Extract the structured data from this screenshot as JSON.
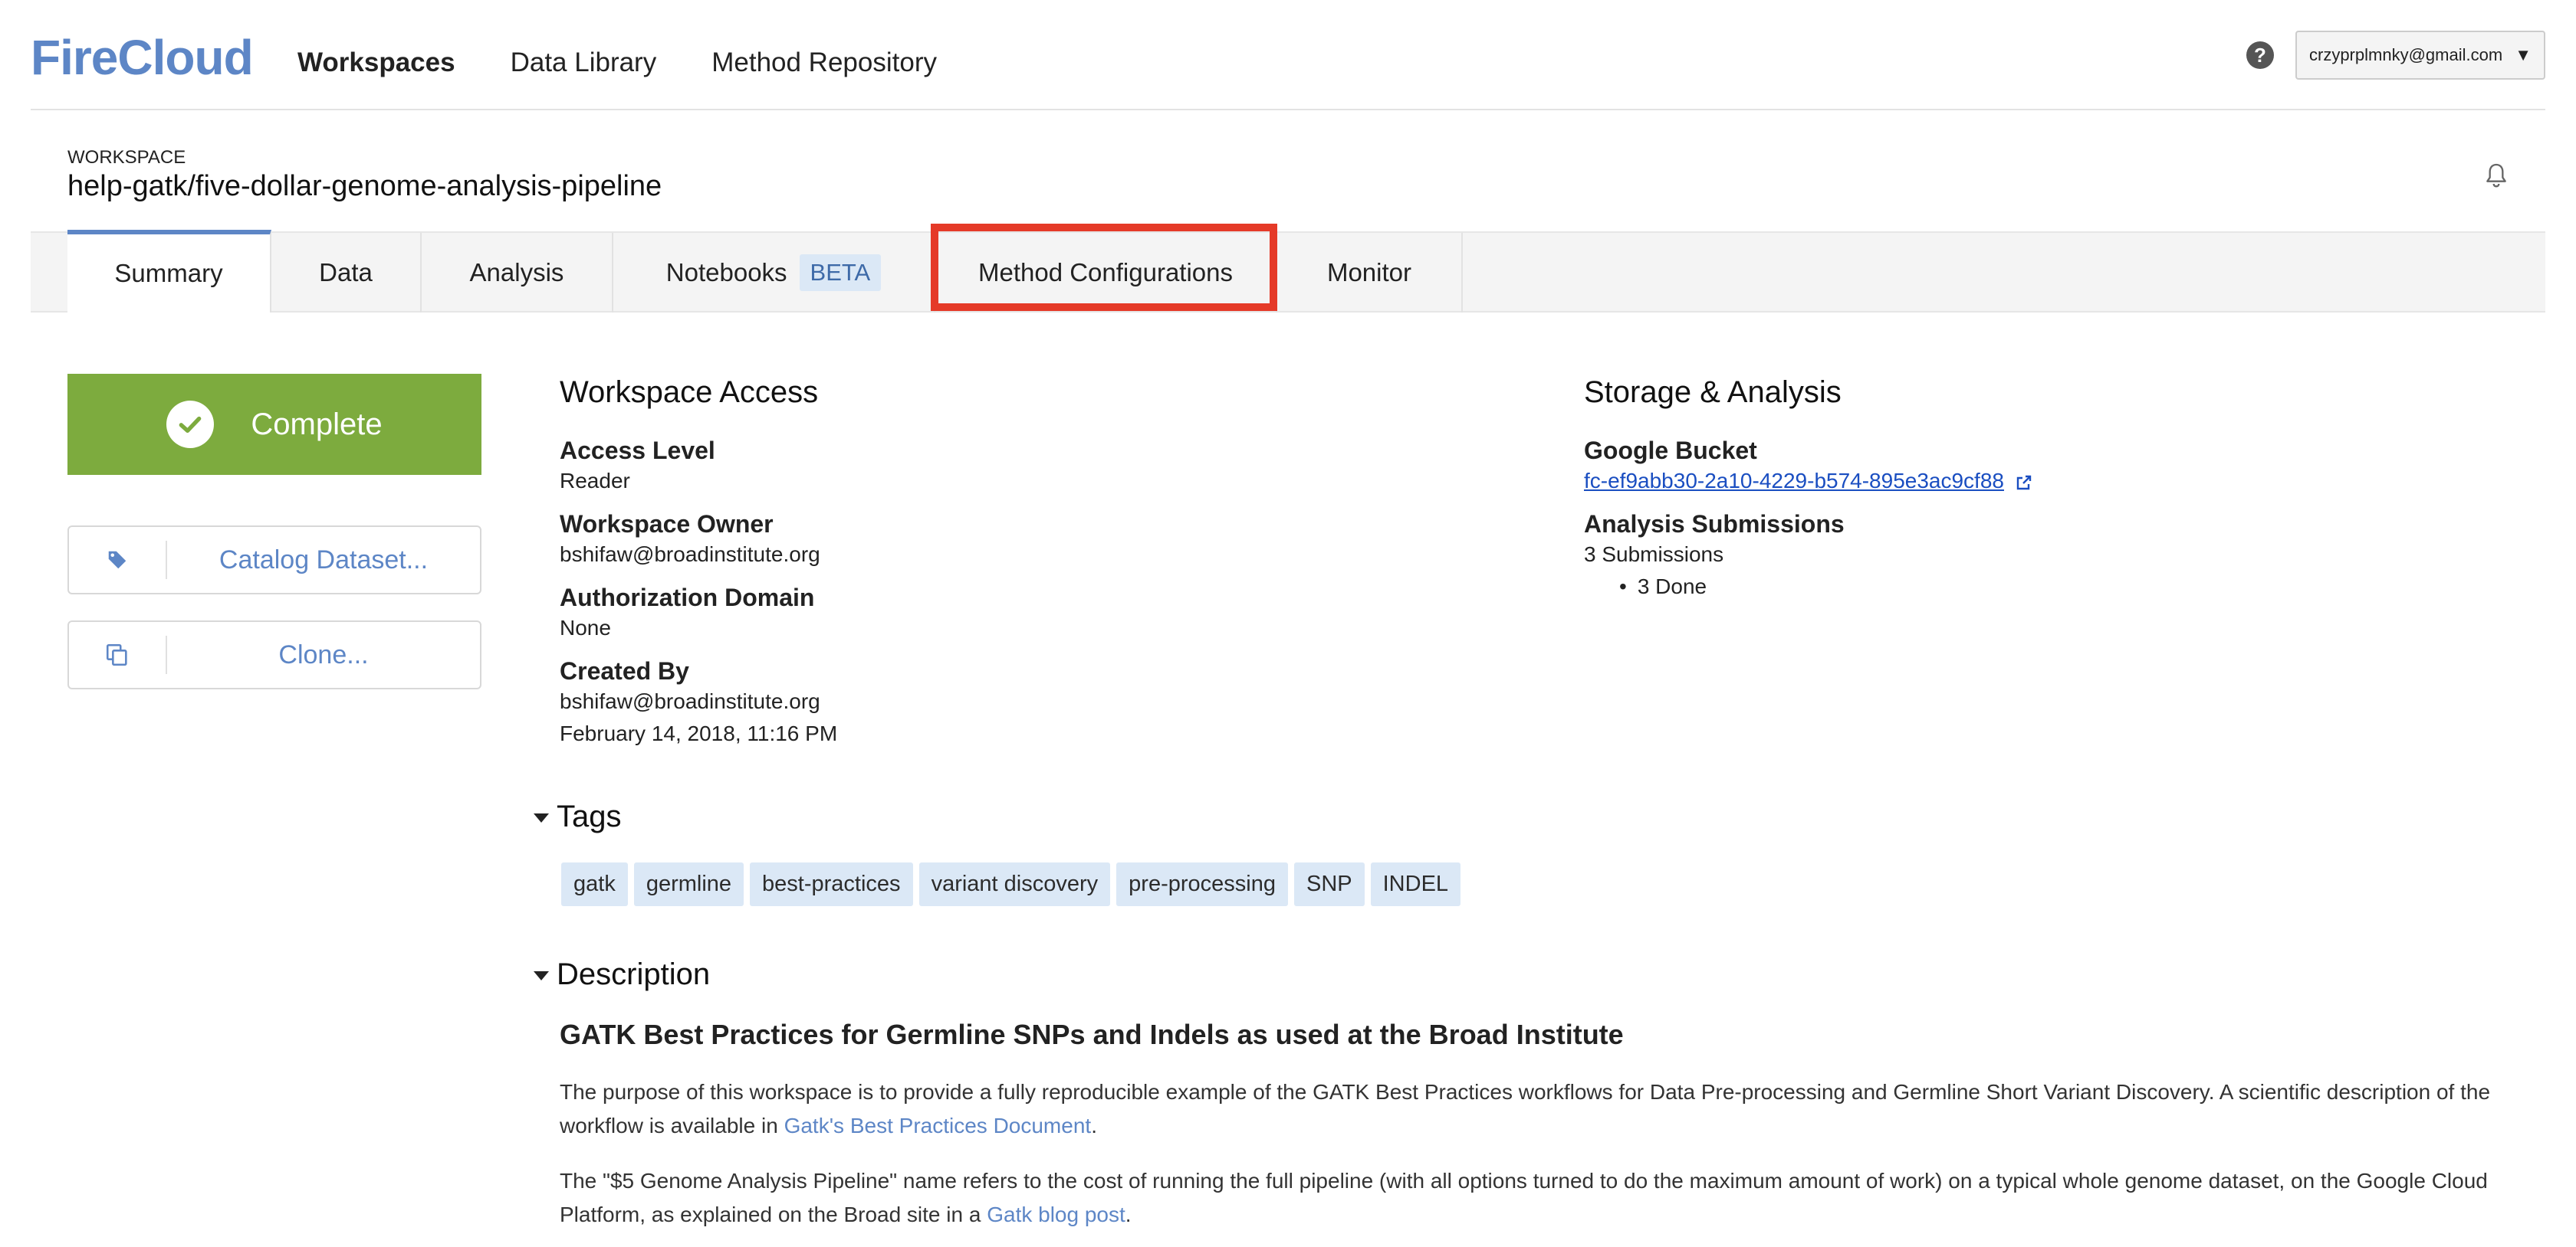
{
  "app": {
    "logo": "FireCloud"
  },
  "nav": {
    "workspaces": "Workspaces",
    "data_library": "Data Library",
    "method_repository": "Method Repository"
  },
  "header": {
    "help_icon": "question-circle-icon",
    "user_email": "crzyprplmnky@gmail.com",
    "user_caret": "▼"
  },
  "workspace": {
    "label": "WORKSPACE",
    "name": "help-gatk/five-dollar-genome-analysis-pipeline"
  },
  "tabs": [
    {
      "label": "Summary",
      "active": true
    },
    {
      "label": "Data"
    },
    {
      "label": "Analysis"
    },
    {
      "label": "Notebooks",
      "badge": "BETA"
    },
    {
      "label": "Method Configurations",
      "highlighted": true
    },
    {
      "label": "Monitor"
    }
  ],
  "sidebar": {
    "status": "Complete",
    "catalog_button": "Catalog Dataset...",
    "clone_button": "Clone..."
  },
  "access": {
    "title": "Workspace Access",
    "access_level_label": "Access Level",
    "access_level_value": "Reader",
    "owner_label": "Workspace Owner",
    "owner_value": "bshifaw@broadinstitute.org",
    "auth_domain_label": "Authorization Domain",
    "auth_domain_value": "None",
    "created_by_label": "Created By",
    "created_by_value": "bshifaw@broadinstitute.org",
    "created_date": "February 14, 2018, 11:16 PM"
  },
  "storage": {
    "title": "Storage & Analysis",
    "bucket_label": "Google Bucket",
    "bucket_value": "fc-ef9abb30-2a10-4229-b574-895e3ac9cf88",
    "submissions_label": "Analysis Submissions",
    "submissions_count": "3 Submissions",
    "submissions_done": "3 Done"
  },
  "tags": {
    "title": "Tags",
    "items": [
      "gatk",
      "germline",
      "best-practices",
      "variant discovery",
      "pre-processing",
      "SNP",
      "INDEL"
    ]
  },
  "description": {
    "title": "Description",
    "heading": "GATK Best Practices for Germline SNPs and Indels as used at the Broad Institute",
    "para1_text": "The purpose of this workspace is to provide a fully reproducible example of the GATK Best Practices workflows for Data Pre-processing and Germline Short Variant Discovery. A scientific description of the workflow is available in ",
    "para1_link": "Gatk's Best Practices Document",
    "para1_end": ".",
    "para2_text": "The \"$5 Genome Analysis Pipeline\" name refers to the cost of running the full pipeline (with all options turned to do the maximum amount of work) on a typical whole genome dataset, on the Google Cloud Platform, as explained on the Broad site in a ",
    "para2_link": "Gatk blog post",
    "para2_end": "."
  },
  "colors": {
    "brand": "#5d86c6",
    "complete_green": "#7dab3e",
    "highlight_red": "#e53a28",
    "tag_bg": "#dbe8f6"
  }
}
